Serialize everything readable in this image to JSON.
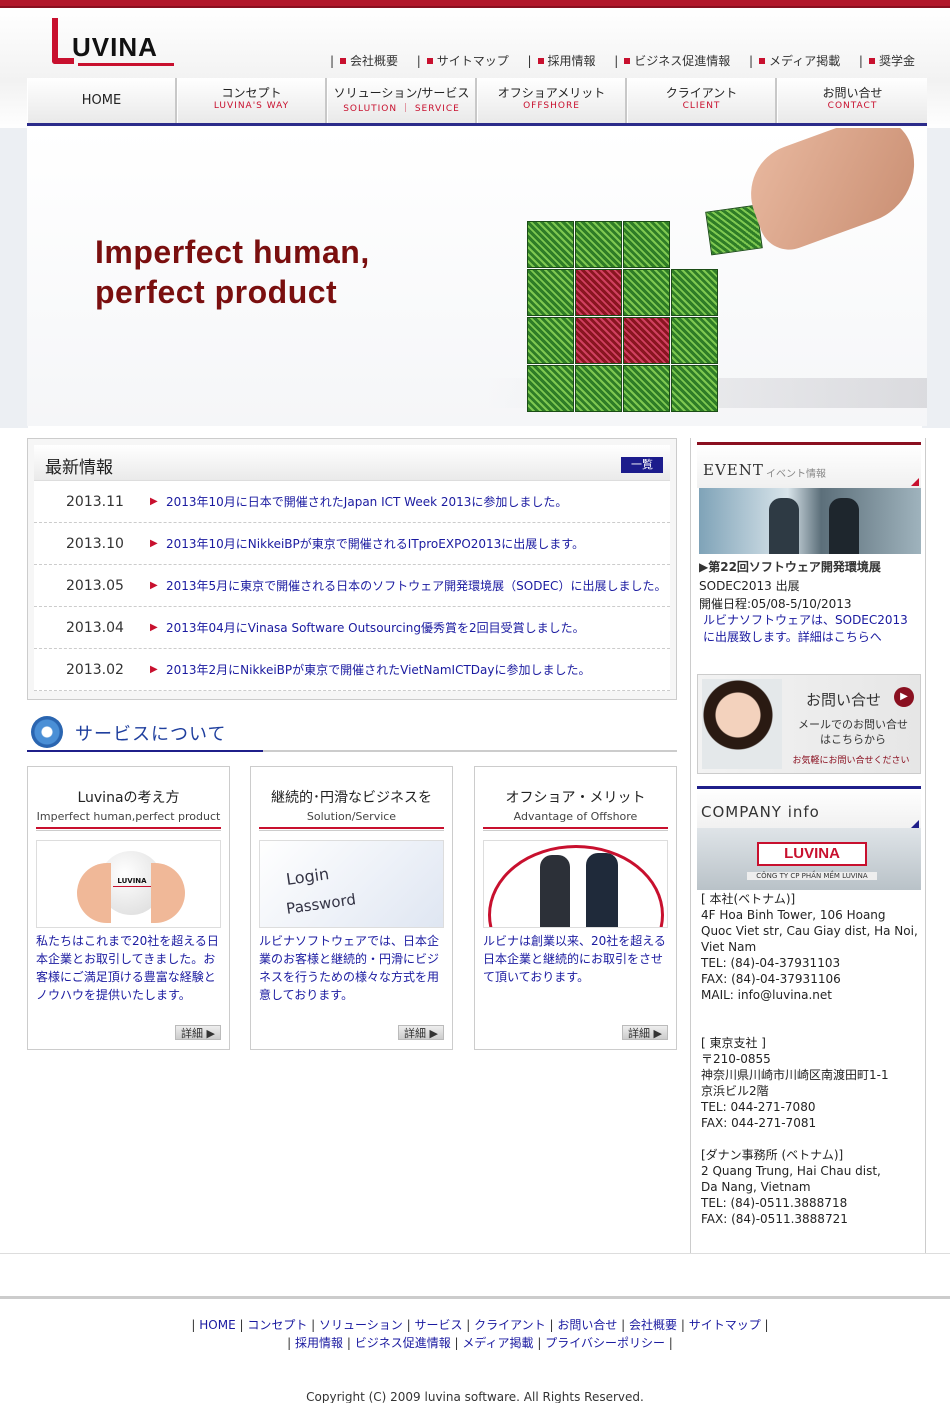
{
  "logo": {
    "text": "UVINA"
  },
  "top_links": [
    "会社概要",
    "サイトマップ",
    "採用情報",
    "ビジネス促進情報",
    "メディア掲載",
    "奨学金"
  ],
  "nav": [
    {
      "jp": "HOME",
      "en": ""
    },
    {
      "jp": "コンセプト",
      "en": "LUVINA'S WAY"
    },
    {
      "jp": "ソリューション/サービス",
      "en": "SOLUTION ｜ SERVICE"
    },
    {
      "jp": "オフショアメリット",
      "en": "OFFSHORE"
    },
    {
      "jp": "クライアント",
      "en": "CLIENT"
    },
    {
      "jp": "お問い合せ",
      "en": "CONTACT"
    }
  ],
  "hero": {
    "line1": "Imperfect human,",
    "line2": "perfect product"
  },
  "news": {
    "title": "最新情報",
    "more": "一覧",
    "items": [
      {
        "date": "2013.11",
        "text": "2013年10月に日本で開催されたJapan ICT Week 2013に参加しました。"
      },
      {
        "date": "2013.10",
        "text": "2013年10月にNikkeiBPが東京で開催されるITproEXPO2013に出展します。"
      },
      {
        "date": "2013.05",
        "text": "2013年5月に東京で開催される日本のソフトウェア開発環境展（SODEC）に出展しました。"
      },
      {
        "date": "2013.04",
        "text": "2013年04月にVinasa Software Outsourcing優秀賞を2回目受賞しました。"
      },
      {
        "date": "2013.02",
        "text": "2013年2月にNikkeiBPが東京で開催されたVietNamICTDayに参加しました。"
      }
    ]
  },
  "services": {
    "title": "サービスについて",
    "cards": [
      {
        "t1": "Luvinaの考え方",
        "t2": "Imperfect human,perfect product",
        "desc": "私たちはこれまで20社を超える日本企業とお取引してきました。お客様にご満足頂ける豊富な経験とノウハウを提供いたします。",
        "more": "詳細 ▶"
      },
      {
        "t1": "継続的･円滑なビジネスを",
        "t2": "Solution/Service",
        "desc": "ルビナソフトウェアでは、日本企業のお客様と継続的・円滑にビジネスを行うための様々な方式を用意しております。",
        "more": "詳細 ▶"
      },
      {
        "t1": "オフショア・メリット",
        "t2": "Advantage of  Offshore",
        "desc": "ルビナは創業以来、20社を超える日本企業と継続的にお取引をさせて頂いております。",
        "more": "詳細 ▶"
      }
    ],
    "card_images": {
      "login": "Login",
      "password": "Password"
    }
  },
  "event": {
    "title": "EVENT",
    "sub": "イベント情報",
    "headline": "▶第22回ソフトウェア開発環境展",
    "line2": "SODEC2013 出展",
    "line3": "開催日程:05/08-5/10/2013",
    "link": "ルビナソフトウェアは、SODEC2013に出展致します。詳細はこちらへ"
  },
  "contact": {
    "title": "お問い合せ",
    "body": "メールでのお問い合せはこちらから",
    "note": "お気軽にお問い合せください"
  },
  "company": {
    "title": "COMPANY info",
    "sign": "LUVINA",
    "sign_sub": "CÔNG TY CP PHẦN MỀM LUVINA",
    "address": "[ 本社(ベトナム)]\n4F Hoa Binh Tower, 106 Hoang Quoc Viet str, Cau Giay dist, Ha Noi, Viet Nam\nTEL: (84)-04-37931103\nFAX: (84)-04-37931106\nMAIL: info@luvina.net\n\n\n[ 東京支社 ]\n〒210-0855\n神奈川県川崎市川崎区南渡田町1-1\n京浜ビル2階\nTEL: 044-271-7080\nFAX: 044-271-7081\n\n[ダナン事務所 (ベトナム)]\n2 Quang Trung, Hai Chau dist,\nDa Nang, Vietnam\nTEL: (84)-0511.3888718\nFAX: (84)-0511.3888721"
  },
  "footer": {
    "links": [
      "HOME",
      "コンセプト",
      "ソリューション",
      "サービス",
      "クライアント",
      "お問い合せ",
      "会社概要",
      "サイトマップ",
      "採用情報",
      "ビジネス促進情報",
      "メディア掲載",
      "プライバシーポリシー"
    ],
    "copyright": "Copyright (C) 2009 luvina software. All Rights Reserved."
  },
  "colors": {
    "brand_red": "#c8102e",
    "nav_blue": "#2b2b8a",
    "hero_text": "#7a0f0f",
    "link": "#1a1aa0"
  }
}
